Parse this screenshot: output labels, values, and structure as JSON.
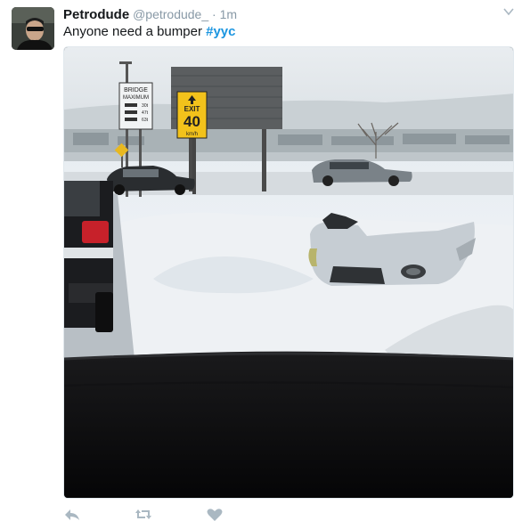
{
  "tweet": {
    "display_name": "Petrodude",
    "handle": "@petrodude_",
    "separator": "·",
    "timestamp": "1m",
    "text_prefix": "Anyone need a bumper ",
    "hashtag": "#yyc"
  },
  "photo": {
    "sign_bridge_line1": "BRIDGE",
    "sign_bridge_line2": "MAXIMUM",
    "sign_bridge_rows": [
      "30t",
      "47t",
      "63t"
    ],
    "sign_exit_label": "EXIT",
    "sign_exit_number": "40",
    "sign_exit_unit": "km/h"
  },
  "actions": {
    "icons": [
      "reply-icon",
      "retweet-icon",
      "like-icon"
    ]
  },
  "colors": {
    "link": "#1b95e0",
    "muted": "#8899a6",
    "text": "#14171a",
    "sign_yellow": "#f2c21b"
  }
}
